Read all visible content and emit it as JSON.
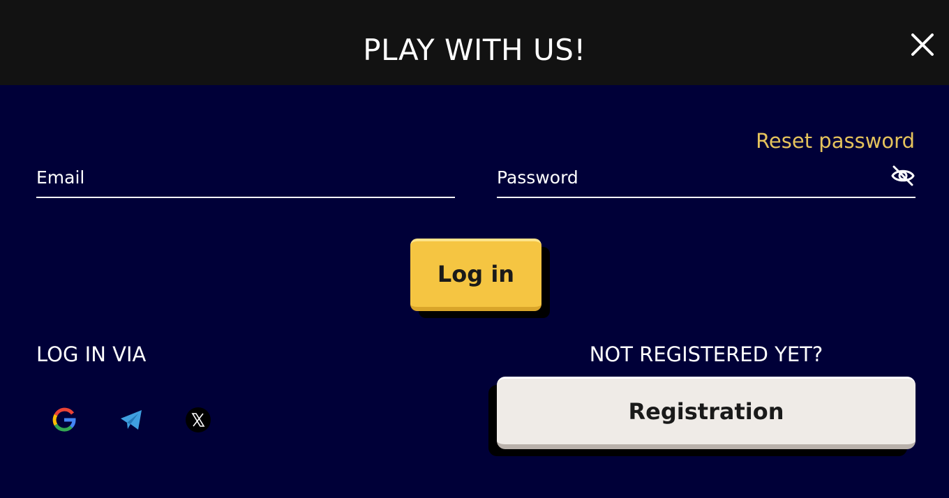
{
  "header": {
    "title": "PLAY WITH US!",
    "close_icon": "close-icon"
  },
  "form": {
    "reset_password_label": "Reset password",
    "email": {
      "placeholder": "Email",
      "value": ""
    },
    "password": {
      "placeholder": "Password",
      "value": "",
      "toggle_icon": "eye-off-icon"
    },
    "login_label": "Log in"
  },
  "social": {
    "label": "LOG IN VIA",
    "providers": [
      {
        "name": "google",
        "icon": "google-icon"
      },
      {
        "name": "telegram",
        "icon": "telegram-icon"
      },
      {
        "name": "x",
        "icon": "x-icon"
      }
    ]
  },
  "registration": {
    "prompt": "NOT REGISTERED YET?",
    "button_label": "Registration"
  },
  "colors": {
    "header_bg": "#121212",
    "body_bg": "#000038",
    "accent_link": "#e5c35c",
    "login_button": "#f5c542",
    "registration_button": "#efebe7"
  }
}
